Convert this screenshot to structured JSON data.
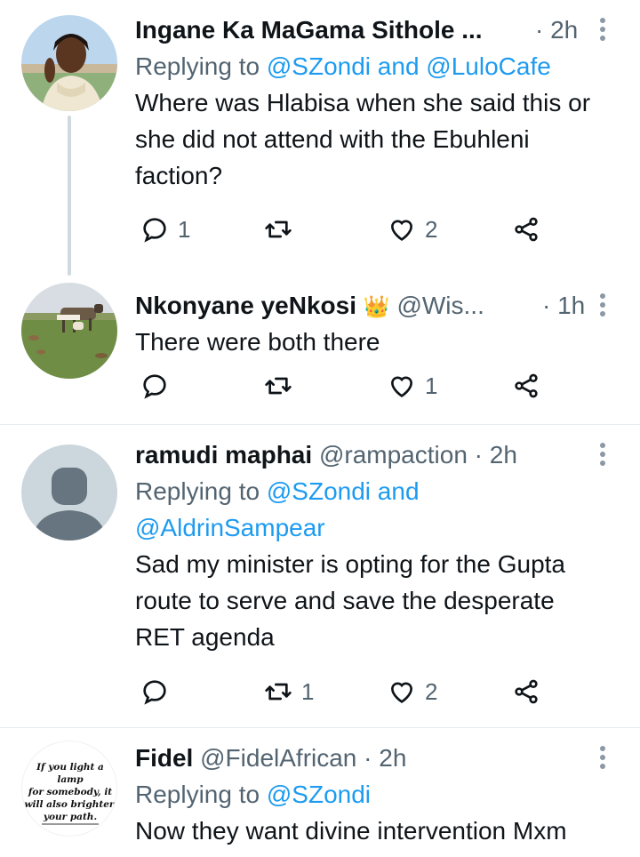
{
  "tweets": [
    {
      "name": "Ingane Ka MaGama Sithole ...",
      "handle": "",
      "time": "· 2h",
      "replying_prefix": "Replying to ",
      "replying_mentions": "@SZondi and @LuloCafe",
      "text_lines": [
        "Where was Hlabisa when she said this or",
        "she did not attend with the Ebuhleni",
        "faction?"
      ],
      "replies": "1",
      "retweets": "",
      "likes": "2",
      "avatar_icon": "person-photo-avatar"
    },
    {
      "name": "Nkonyane yeNkosi",
      "emoji": "👑",
      "handle": "@Wis...",
      "time": "· 1h",
      "text_lines": [
        "There were both there"
      ],
      "replies": "",
      "retweets": "",
      "likes": "1",
      "avatar_icon": "cattle-field-avatar"
    },
    {
      "name": "ramudi maphai",
      "handle": "@rampaction",
      "time": "· 2h",
      "replying_prefix": "Replying to ",
      "replying_mentions_line1": "@SZondi and",
      "replying_mentions_line2": "@AldrinSampear",
      "text_lines": [
        "Sad my minister is opting for the Gupta",
        "route to serve and save the desperate",
        "RET agenda"
      ],
      "replies": "",
      "retweets": "1",
      "likes": "2",
      "avatar_icon": "default-profile-avatar"
    },
    {
      "name": "Fidel",
      "handle": "@FidelAfrican",
      "time": "· 2h",
      "replying_prefix": "Replying to ",
      "replying_mentions": "@SZondi",
      "text_lines": [
        "Now they want divine intervention Mxm"
      ],
      "avatar_quote_lines": [
        "If you light a lamp",
        "for somebody, it",
        "will also brighten",
        "your path."
      ],
      "avatar_icon": "quote-image-avatar"
    }
  ],
  "colors": {
    "link": "#1d9bf0",
    "muted": "#536471",
    "text": "#0f1419",
    "divider": "#e6ecf0"
  },
  "icons": [
    "reply-icon",
    "retweet-icon",
    "like-icon",
    "share-icon",
    "more-icon"
  ]
}
